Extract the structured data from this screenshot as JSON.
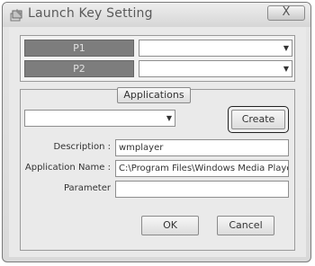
{
  "window": {
    "title": "Launch Key Setting",
    "close_label": "X"
  },
  "keys": [
    {
      "label": "P1",
      "value": ""
    },
    {
      "label": "P2",
      "value": ""
    }
  ],
  "applications": {
    "group_label": "Applications",
    "selected": "",
    "create_label": "Create"
  },
  "fields": {
    "description": {
      "label": "Description :",
      "value": "wmplayer"
    },
    "application_name": {
      "label": "Application Name :",
      "value": "C:\\Program Files\\Windows Media Playe"
    },
    "parameter": {
      "label": "Parameter",
      "value": ""
    }
  },
  "footer": {
    "ok_label": "OK",
    "cancel_label": "Cancel"
  }
}
